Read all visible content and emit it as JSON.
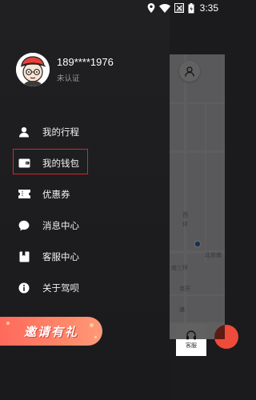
{
  "status_bar": {
    "time": "3:35",
    "icons": [
      "location-icon",
      "wifi-icon",
      "signal-icon",
      "battery-icon"
    ]
  },
  "profile": {
    "phone": "189****1976",
    "verify_status": "未认证"
  },
  "menu": {
    "items": [
      {
        "label": "我的行程",
        "icon": "person-icon"
      },
      {
        "label": "我的钱包",
        "icon": "wallet-icon"
      },
      {
        "label": "优惠券",
        "icon": "ticket-icon"
      },
      {
        "label": "消息中心",
        "icon": "chat-bubble-icon"
      },
      {
        "label": "客服中心",
        "icon": "bookmark-icon"
      },
      {
        "label": "关于驾呗",
        "icon": "info-icon"
      }
    ]
  },
  "banner": {
    "label": "邀请有礼"
  },
  "map": {
    "labels": [
      "西",
      "环",
      "北京南",
      "南三环",
      "京开",
      "速"
    ],
    "service_label": "客服"
  },
  "colors": {
    "drawer_bg": "#1b1b1d",
    "highlight": "#d8252b",
    "banner": "#ff7a63",
    "accent": "#ee4b3b"
  }
}
